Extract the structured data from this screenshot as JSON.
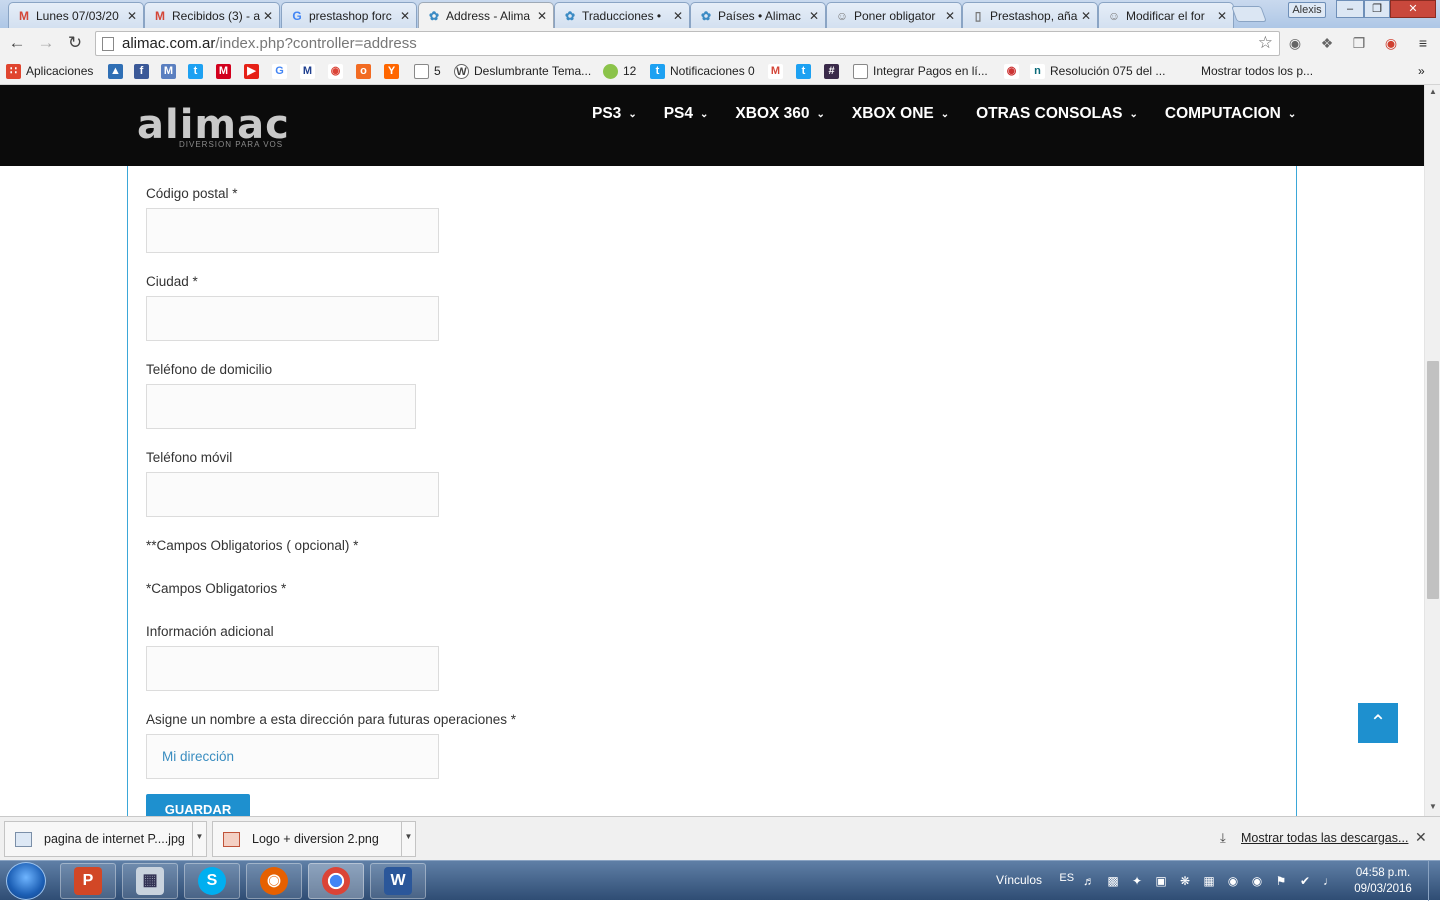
{
  "browser": {
    "tabs": [
      {
        "title": "Lunes 07/03/20",
        "favicon": "gmail-icon",
        "color": "#d44638",
        "glyph": "M"
      },
      {
        "title": "Recibidos (3) - a",
        "favicon": "gmail-icon",
        "color": "#d44638",
        "glyph": "M"
      },
      {
        "title": "prestashop forc",
        "favicon": "google-icon",
        "color": "#4285f4",
        "glyph": "G"
      },
      {
        "title": "Address - Alima",
        "favicon": "prestashop-icon",
        "color": "#3b8bc4",
        "glyph": "✿",
        "active": true
      },
      {
        "title": "Traducciones •",
        "favicon": "prestashop-icon",
        "color": "#3b8bc4",
        "glyph": "✿"
      },
      {
        "title": "Países • Alimac",
        "favicon": "prestashop-icon",
        "color": "#3b8bc4",
        "glyph": "✿"
      },
      {
        "title": "Poner obligator",
        "favicon": "forum-icon",
        "color": "#777777",
        "glyph": "☺"
      },
      {
        "title": "Prestashop, aña",
        "favicon": "page-icon",
        "color": "#777777",
        "glyph": "▯"
      },
      {
        "title": "Modificar el for",
        "favicon": "forum-icon",
        "color": "#777777",
        "glyph": "☺"
      }
    ],
    "user_button": "Alexis",
    "url_host": "alimac.com.ar",
    "url_path": "/index.php?controller=address",
    "bookmarks": {
      "apps_label": "Aplicaciones",
      "items": [
        {
          "label": "Deslumbrante Tema...",
          "icon": "wordpress-icon"
        },
        {
          "label": "12",
          "icon": "plate-icon"
        },
        {
          "label": "Notificaciones 0",
          "icon": "twitter-icon"
        },
        {
          "label": "5",
          "icon": "page-icon"
        },
        {
          "label": "Integrar Pagos en lí...",
          "icon": "page-icon"
        },
        {
          "label": "Resolución 075 del ...",
          "icon": "n-icon"
        }
      ],
      "more_label": "Mostrar todos los p..."
    }
  },
  "site": {
    "logo_word": "alimac",
    "logo_tagline": "DIVERSION PARA VOS",
    "menu": [
      "PS3",
      "PS4",
      "XBOX 360",
      "XBOX ONE",
      "OTRAS CONSOLAS",
      "COMPUTACION"
    ],
    "form": {
      "postcode_label": "Código postal *",
      "city_label": "Ciudad *",
      "home_phone_label": "Teléfono de domicilio",
      "mobile_phone_label": "Teléfono móvil",
      "required_optional_note": "**Campos Obligatorios ( opcional) *",
      "required_note": "*Campos Obligatorios *",
      "additional_info_label": "Información adicional",
      "alias_label": "Asigne un nombre a esta dirección para futuras operaciones *",
      "alias_value": "Mi dirección",
      "save_button": "GUARDAR"
    },
    "accent_color": "#1e90cf"
  },
  "downloads": {
    "items": [
      "pagina de internet P....jpg",
      "Logo + diversion 2.png"
    ],
    "show_all": "Mostrar todas las descargas..."
  },
  "taskbar": {
    "links_label": "Vínculos",
    "lang": "ES",
    "time": "04:58 p.m.",
    "date": "09/03/2016"
  }
}
